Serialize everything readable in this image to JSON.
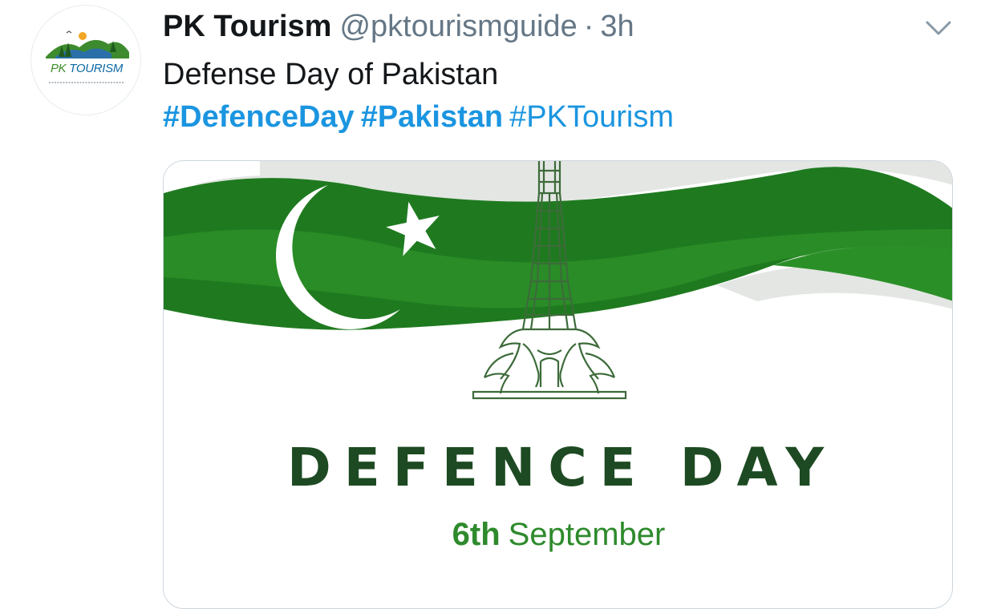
{
  "tweet": {
    "display_name": "PK Tourism",
    "handle": "@pktourismguide",
    "separator": "·",
    "time": "3h",
    "text": "Defense Day of Pakistan",
    "hashtags": [
      {
        "text": "#DefenceDay",
        "bold": true
      },
      {
        "text": "#Pakistan",
        "bold": true
      },
      {
        "text": "#PKTourism",
        "bold": false
      }
    ]
  },
  "avatar": {
    "logo_pk": "PK",
    "logo_tourism": "TOURISM"
  },
  "media": {
    "title": "DEFENCE DAY",
    "date_day": "6th",
    "date_month": "September"
  },
  "icons": {
    "menu": "chevron-down-icon",
    "flag": "pakistan-flag-banner",
    "monument": "minar-e-pakistan-icon"
  },
  "colors": {
    "link": "#1b95e0",
    "text": "#14171a",
    "muted": "#657786",
    "flag_green": "#1f7a1f",
    "title_green": "#1d4a22"
  }
}
